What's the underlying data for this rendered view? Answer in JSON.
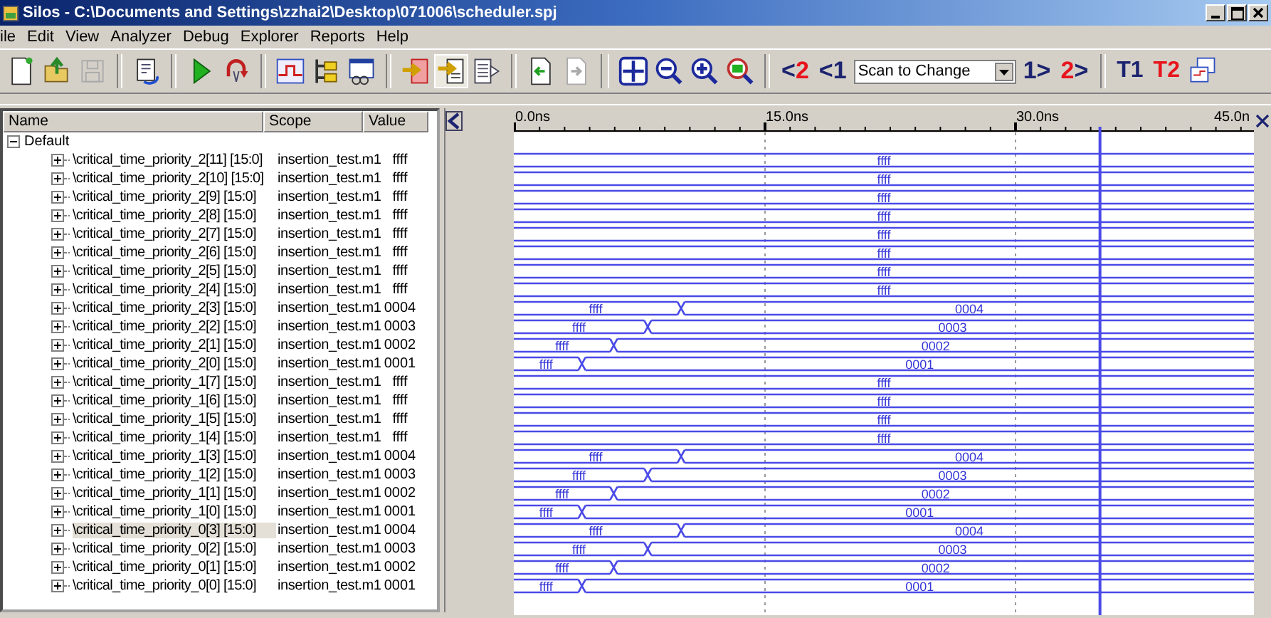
{
  "window": {
    "title": "Silos - C:\\Documents and Settings\\zzhai2\\Desktop\\071006\\scheduler.spj"
  },
  "menu": [
    "ile",
    "Edit",
    "View",
    "Analyzer",
    "Debug",
    "Explorer",
    "Reports",
    "Help"
  ],
  "toolbar": {
    "back": [
      {
        "arrow": "<",
        "number": "2",
        "color": "#e8141c"
      },
      {
        "arrow": "<",
        "number": "1",
        "color": "#1c2470"
      }
    ],
    "scan_mode": "Scan to Change",
    "forward": [
      {
        "number": "1",
        "arrow": ">",
        "color": "#1c2470"
      },
      {
        "number": "2",
        "arrow": ">",
        "color": "#e8141c"
      }
    ],
    "markers": [
      {
        "label": "T1",
        "color": "#1c2470"
      },
      {
        "label": "T2",
        "color": "#e8141c"
      }
    ]
  },
  "signals": {
    "columns": [
      "Name",
      "Scope",
      "Value"
    ],
    "tree": {
      "label": "Default",
      "expanded": true,
      "children": [
        {
          "name": "\\critical_time_priority_2[11] [15:0]",
          "scope": "insertion_test.m1",
          "value": "ffff",
          "expanded": false,
          "selected": false,
          "wave": [
            {
              "value": "ffff"
            }
          ]
        },
        {
          "name": "\\critical_time_priority_2[10] [15:0]",
          "scope": "insertion_test.m1",
          "value": "ffff",
          "expanded": false,
          "selected": false,
          "wave": [
            {
              "value": "ffff"
            }
          ]
        },
        {
          "name": "\\critical_time_priority_2[9] [15:0]",
          "scope": "insertion_test.m1",
          "value": "ffff",
          "expanded": false,
          "selected": false,
          "wave": [
            {
              "value": "ffff"
            }
          ]
        },
        {
          "name": "\\critical_time_priority_2[8] [15:0]",
          "scope": "insertion_test.m1",
          "value": "ffff",
          "expanded": false,
          "selected": false,
          "wave": [
            {
              "value": "ffff"
            }
          ]
        },
        {
          "name": "\\critical_time_priority_2[7] [15:0]",
          "scope": "insertion_test.m1",
          "value": "ffff",
          "expanded": false,
          "selected": false,
          "wave": [
            {
              "value": "ffff"
            }
          ]
        },
        {
          "name": "\\critical_time_priority_2[6] [15:0]",
          "scope": "insertion_test.m1",
          "value": "ffff",
          "expanded": false,
          "selected": false,
          "wave": [
            {
              "value": "ffff"
            }
          ]
        },
        {
          "name": "\\critical_time_priority_2[5] [15:0]",
          "scope": "insertion_test.m1",
          "value": "ffff",
          "expanded": false,
          "selected": false,
          "wave": [
            {
              "value": "ffff"
            }
          ]
        },
        {
          "name": "\\critical_time_priority_2[4] [15:0]",
          "scope": "insertion_test.m1",
          "value": "ffff",
          "expanded": false,
          "selected": false,
          "wave": [
            {
              "value": "ffff"
            }
          ]
        },
        {
          "name": "\\critical_time_priority_2[3] [15:0]",
          "scope": "insertion_test.m1",
          "value": "0004",
          "expanded": false,
          "selected": false,
          "wave": [
            {
              "value": "ffff",
              "level": 0.226
            },
            {
              "value": "0004"
            }
          ]
        },
        {
          "name": "\\critical_time_priority_2[2] [15:0]",
          "scope": "insertion_test.m1",
          "value": "0003",
          "expanded": false,
          "selected": false,
          "wave": [
            {
              "value": "ffff",
              "level": 0.181
            },
            {
              "value": "0003"
            }
          ]
        },
        {
          "name": "\\critical_time_priority_2[1] [15:0]",
          "scope": "insertion_test.m1",
          "value": "0002",
          "expanded": false,
          "selected": false,
          "wave": [
            {
              "value": "ffff",
              "level": 0.135
            },
            {
              "value": "0002"
            }
          ]
        },
        {
          "name": "\\critical_time_priority_2[0] [15:0]",
          "scope": "insertion_test.m1",
          "value": "0001",
          "expanded": false,
          "selected": false,
          "wave": [
            {
              "value": "ffff",
              "level": 0.092
            },
            {
              "value": "0001"
            }
          ]
        },
        {
          "name": "\\critical_time_priority_1[7] [15:0]",
          "scope": "insertion_test.m1",
          "value": "ffff",
          "expanded": false,
          "selected": false,
          "wave": [
            {
              "value": "ffff"
            }
          ]
        },
        {
          "name": "\\critical_time_priority_1[6] [15:0]",
          "scope": "insertion_test.m1",
          "value": "ffff",
          "expanded": false,
          "selected": false,
          "wave": [
            {
              "value": "ffff"
            }
          ]
        },
        {
          "name": "\\critical_time_priority_1[5] [15:0]",
          "scope": "insertion_test.m1",
          "value": "ffff",
          "expanded": false,
          "selected": false,
          "wave": [
            {
              "value": "ffff"
            }
          ]
        },
        {
          "name": "\\critical_time_priority_1[4] [15:0]",
          "scope": "insertion_test.m1",
          "value": "ffff",
          "expanded": false,
          "selected": false,
          "wave": [
            {
              "value": "ffff"
            }
          ]
        },
        {
          "name": "\\critical_time_priority_1[3] [15:0]",
          "scope": "insertion_test.m1",
          "value": "0004",
          "expanded": false,
          "selected": false,
          "wave": [
            {
              "value": "ffff",
              "level": 0.226
            },
            {
              "value": "0004"
            }
          ]
        },
        {
          "name": "\\critical_time_priority_1[2] [15:0]",
          "scope": "insertion_test.m1",
          "value": "0003",
          "expanded": false,
          "selected": false,
          "wave": [
            {
              "value": "ffff",
              "level": 0.181
            },
            {
              "value": "0003"
            }
          ]
        },
        {
          "name": "\\critical_time_priority_1[1] [15:0]",
          "scope": "insertion_test.m1",
          "value": "0002",
          "expanded": false,
          "selected": false,
          "wave": [
            {
              "value": "ffff",
              "level": 0.135
            },
            {
              "value": "0002"
            }
          ]
        },
        {
          "name": "\\critical_time_priority_1[0] [15:0]",
          "scope": "insertion_test.m1",
          "value": "0001",
          "expanded": false,
          "selected": false,
          "wave": [
            {
              "value": "ffff",
              "level": 0.092
            },
            {
              "value": "0001"
            }
          ]
        },
        {
          "name": "\\critical_time_priority_0[3] [15:0]",
          "scope": "insertion_test.m1",
          "value": "0004",
          "expanded": false,
          "selected": true,
          "wave": [
            {
              "value": "ffff",
              "level": 0.226
            },
            {
              "value": "0004"
            }
          ]
        },
        {
          "name": "\\critical_time_priority_0[2] [15:0]",
          "scope": "insertion_test.m1",
          "value": "0003",
          "expanded": false,
          "selected": false,
          "wave": [
            {
              "value": "ffff",
              "level": 0.181
            },
            {
              "value": "0003"
            }
          ]
        },
        {
          "name": "\\critical_time_priority_0[1] [15:0]",
          "scope": "insertion_test.m1",
          "value": "0002",
          "expanded": false,
          "selected": false,
          "wave": [
            {
              "value": "ffff",
              "level": 0.135
            },
            {
              "value": "0002"
            }
          ]
        },
        {
          "name": "\\critical_time_priority_0[0] [15:0]",
          "scope": "insertion_test.m1",
          "value": "0001",
          "expanded": false,
          "selected": false,
          "wave": [
            {
              "value": "ffff",
              "level": 0.092
            },
            {
              "value": "0001"
            }
          ]
        }
      ]
    }
  },
  "waveform": {
    "ticks": [
      "0.0ns",
      "15.0ns",
      "30.0ns",
      "45.0n"
    ],
    "cursor": {
      "level": 0.792
    }
  }
}
